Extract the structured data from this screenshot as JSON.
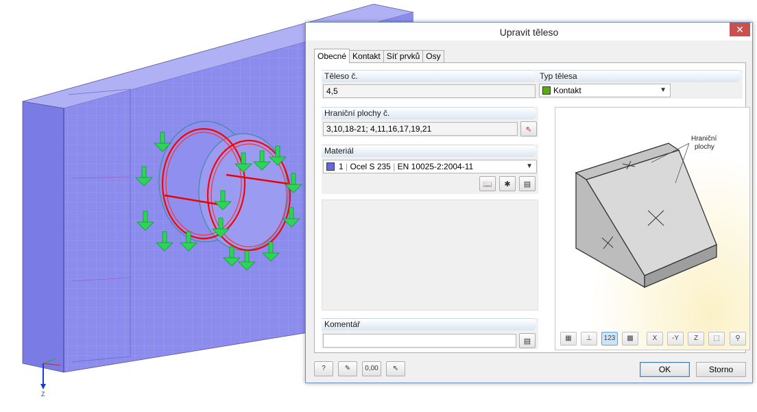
{
  "dialog": {
    "title": "Upravit těleso",
    "close_glyph": "✕",
    "tabs": [
      {
        "label": "Obecné",
        "active": true
      },
      {
        "label": "Kontakt",
        "active": false
      },
      {
        "label": "Síť prvků",
        "active": false
      },
      {
        "label": "Osy",
        "active": false
      }
    ],
    "body_no": {
      "label": "Těleso č.",
      "value": "4,5"
    },
    "body_type": {
      "label": "Typ tělesa",
      "value": "Kontakt",
      "color": "#5aab0c"
    },
    "boundary": {
      "label": "Hraniční plochy č.",
      "value": "3,10,18-21; 4,11,16,17,19,21"
    },
    "material": {
      "label": "Materiál",
      "number": "1",
      "name": "Ocel S 235",
      "norm": "EN 10025-2:2004-11",
      "color": "#6666e0"
    },
    "comment": {
      "label": "Komentář",
      "value": ""
    },
    "preview": {
      "annotation_line1": "Hraniční",
      "annotation_line2": "plochy"
    },
    "preview_toolbar": {
      "numbering_label": "123",
      "axis_x": "X",
      "axis_neg_y": "-Y",
      "axis_z": "Z"
    },
    "bottom_tools": {
      "calc_label": "0,00"
    },
    "ok_label": "OK",
    "cancel_label": "Storno"
  },
  "model": {
    "axis_label": "Z",
    "colors": {
      "slab": "#8080ee",
      "load": "#22cc44",
      "ring": "#ff0000"
    }
  }
}
